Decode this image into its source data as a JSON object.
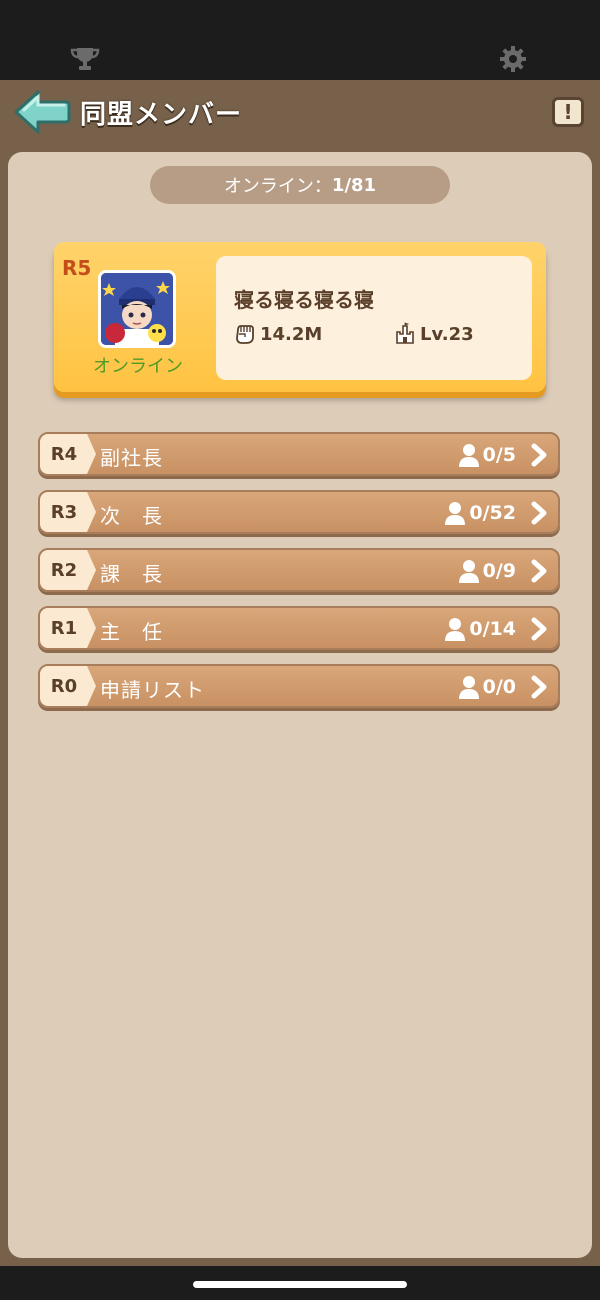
{
  "colors": {
    "header_bg": "#77614b",
    "panel_bg": "#ddccb8",
    "leader_bg": "#ffc342",
    "row_bg": "#c89163",
    "online_green": "#4f9a26",
    "rank_red": "#c44e1a"
  },
  "topbar": {
    "left_icon": "trophy-icon",
    "right_icon": "gear-icon"
  },
  "header": {
    "title": "同盟メンバー",
    "back_icon": "back-arrow-icon",
    "info_icon": "exclamation-icon",
    "info_label": "!"
  },
  "online": {
    "label": "オンライン：",
    "count": "1/81"
  },
  "leader": {
    "rank": "R5",
    "status": "オンライン",
    "name": "寝る寝る寝る寝",
    "power": "14.2M",
    "level": "Lv.23",
    "power_icon": "fist-icon",
    "level_icon": "castle-icon"
  },
  "ranks": [
    {
      "tag": "R4",
      "label": "副社長",
      "count": "0/5"
    },
    {
      "tag": "R3",
      "label": "次　長",
      "count": "0/52"
    },
    {
      "tag": "R2",
      "label": "課　長",
      "count": "0/9"
    },
    {
      "tag": "R1",
      "label": "主　任",
      "count": "0/14"
    },
    {
      "tag": "R0",
      "label": "申請リスト",
      "count": "0/0"
    }
  ]
}
